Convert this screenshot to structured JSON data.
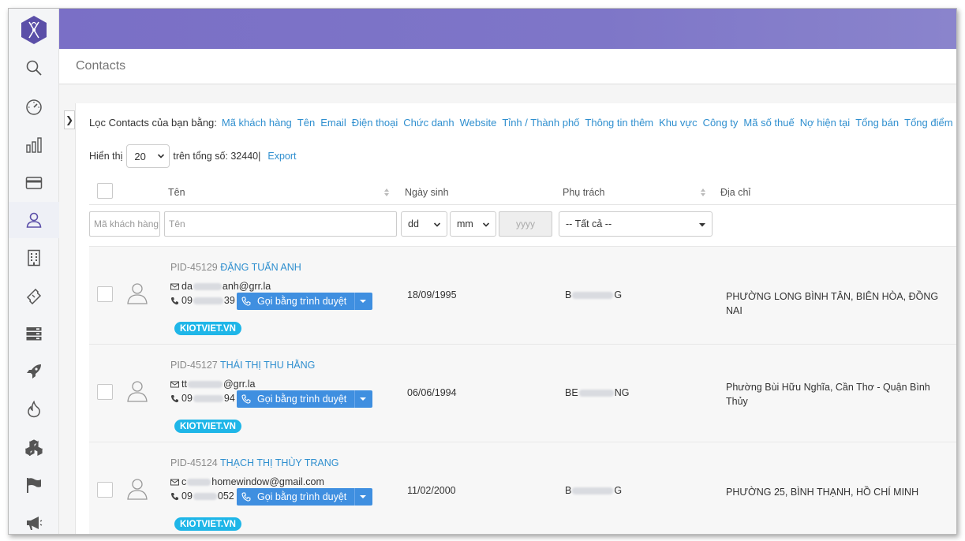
{
  "app": {
    "page_title": "Contacts"
  },
  "filter": {
    "label": "Lọc Contacts của bạn bằng:",
    "links": [
      "Mã khách hàng",
      "Tên",
      "Email",
      "Điện thoại",
      "Chức danh",
      "Website",
      "Tỉnh / Thành phố",
      "Thông tin thêm",
      "Khu vực",
      "Công ty",
      "Mã số thuế",
      "Nợ hiện tại",
      "Tổng bán",
      "Tổng điểm"
    ]
  },
  "display": {
    "show_label": "Hiển thị",
    "page_size": "20",
    "total_label": "trên tổng số: 32440",
    "divider": "|",
    "export_label": "Export"
  },
  "table": {
    "headers": {
      "name": "Tên",
      "dob": "Ngày sinh",
      "owner": "Phụ trách",
      "address": "Địa chỉ"
    },
    "filters": {
      "code_placeholder": "Mã khách hàng",
      "name_placeholder": "Tên",
      "day": "dd",
      "month": "mm",
      "year_placeholder": "yyyy",
      "owner_all": "-- Tất cả --"
    },
    "call_label": "Gọi bằng trình duyệt",
    "rows": [
      {
        "pid": "PID-45129",
        "name": "ĐẶNG TUẤN ANH",
        "email_pre": "da",
        "email_post": "anh@grr.la",
        "phone_pre": "09",
        "phone_post": "39",
        "badge": "KIOTVIET.VN",
        "dob": "18/09/1995",
        "owner_pre": "B",
        "owner_post": "G",
        "address": "PHƯỜNG LONG BÌNH TÂN, BIÊN HÒA, ĐỒNG NAI"
      },
      {
        "pid": "PID-45127",
        "name": "THÁI THỊ THU HẰNG",
        "email_pre": "tt",
        "email_post": "@grr.la",
        "phone_pre": "09",
        "phone_post": "94",
        "badge": "KIOTVIET.VN",
        "dob": "06/06/1994",
        "owner_pre": "BE",
        "owner_post": "NG",
        "address": "Phường Bùi Hữu Nghĩa, Cần Thơ - Quận Bình Thủy"
      },
      {
        "pid": "PID-45124",
        "name": "THẠCH THỊ THÙY TRANG",
        "email_pre": "c",
        "email_post": "homewindow@gmail.com",
        "phone_pre": "09",
        "phone_post": "052",
        "badge": "KIOTVIET.VN",
        "dob": "11/02/2000",
        "owner_pre": "B",
        "owner_post": "G",
        "address": "PHƯỜNG 25, BÌNH THẠNH, HỒ CHÍ MINH"
      }
    ]
  }
}
